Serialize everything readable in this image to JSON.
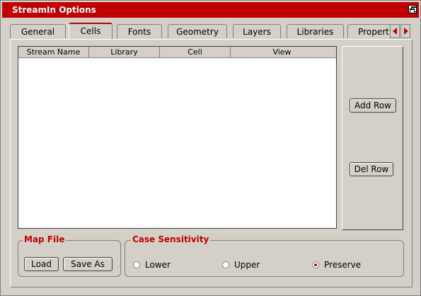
{
  "window": {
    "title": "StreamIn Options"
  },
  "tabs": [
    {
      "label": "General",
      "active": false
    },
    {
      "label": "Cells",
      "active": true
    },
    {
      "label": "Fonts",
      "active": false
    },
    {
      "label": "Geometry",
      "active": false
    },
    {
      "label": "Layers",
      "active": false
    },
    {
      "label": "Libraries",
      "active": false
    },
    {
      "label": "Propert",
      "active": false
    }
  ],
  "table": {
    "columns": [
      "Stream Name",
      "Library",
      "Cell",
      "View"
    ],
    "rows": []
  },
  "side_buttons": {
    "add_row": "Add Row",
    "del_row": "Del Row"
  },
  "map_file": {
    "label": "Map File",
    "load": "Load",
    "save_as": "Save As"
  },
  "case_sensitivity": {
    "label": "Case Sensitivity",
    "options": [
      "Lower",
      "Upper",
      "Preserve"
    ],
    "selected": "Preserve"
  },
  "colors": {
    "accent": "#c00000",
    "background": "#d4d0c8"
  }
}
